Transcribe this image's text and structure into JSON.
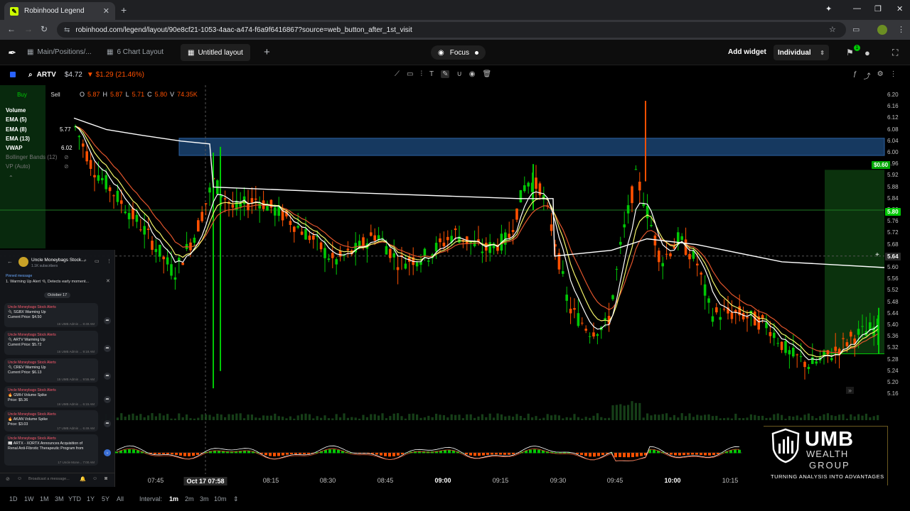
{
  "browser": {
    "tab_title": "Robinhood Legend",
    "url_site": "⇆",
    "url": "robinhood.com/legend/layout/90e8cf21-1053-4aac-a474-f6a9f6416867?source=web_button_after_1st_visit"
  },
  "header": {
    "tabs": [
      {
        "label": "Main/Positions/..."
      },
      {
        "label": "6 Chart Layout"
      },
      {
        "label": "Untitled layout"
      }
    ],
    "focus_label": "Focus",
    "add_widget_label": "Add widget",
    "account_label": "Individual",
    "notification_count": "1"
  },
  "symbol_bar": {
    "symbol": "ARTV",
    "price": "$4.72",
    "change": "▼ $1.29 (21.46%)"
  },
  "ohlc": {
    "o_label": "O",
    "o": "5.87",
    "h_label": "H",
    "h": "5.87",
    "l_label": "L",
    "l": "5.71",
    "c_label": "C",
    "c": "5.80",
    "v_label": "V",
    "v": "74.35K"
  },
  "legend": {
    "buy": "Buy",
    "sell": "Sell",
    "indicators": [
      {
        "name": "Volume",
        "value": ""
      },
      {
        "name": "EMA (5)",
        "value": ""
      },
      {
        "name": "EMA (8)",
        "value": "5.77"
      },
      {
        "name": "EMA (13)",
        "value": ""
      },
      {
        "name": "VWAP",
        "value": "6.02"
      },
      {
        "name": "Bollinger Bands (12)",
        "value": ""
      },
      {
        "name": "VP (Auto)",
        "value": ""
      }
    ]
  },
  "price_axis": {
    "ticks": [
      "6.20",
      "6.16",
      "6.12",
      "6.08",
      "6.04",
      "6.00",
      "5.96",
      "5.92",
      "5.88",
      "5.84",
      "5.80",
      "5.76",
      "5.72",
      "5.68",
      "5.64",
      "5.60",
      "5.56",
      "5.52",
      "5.48",
      "5.44",
      "5.40",
      "5.36",
      "5.32",
      "5.28",
      "5.24",
      "5.20",
      "5.16"
    ],
    "current_tag": "5.80",
    "crosshair_tag": "5.64",
    "green_tag": "$0.60"
  },
  "time_axis": {
    "labels": [
      "07:45",
      "Oct 17 07:58",
      "08:15",
      "08:30",
      "08:45",
      "09:00",
      "09:15",
      "09:30",
      "09:45",
      "10:00",
      "10:15"
    ]
  },
  "bottom": {
    "ranges": [
      "1D",
      "1W",
      "1M",
      "3M",
      "YTD",
      "1Y",
      "5Y",
      "All"
    ],
    "interval_label": "Interval:",
    "intervals": [
      "1m",
      "2m",
      "3m",
      "10m"
    ]
  },
  "telegram": {
    "channel": "Uncle Moneybags Stock...",
    "subscribers": "1.1K subscribers",
    "pinned_label": "Pinned message",
    "pinned_text": "1. Warming Up Alert 🔌 Detects early moment...",
    "date": "October 17",
    "messages": [
      {
        "title": "Uncle Moneybags Stock Alerts",
        "line1": "🔌 SGBX Warming Up",
        "line2": "Current Price: $4.50",
        "meta": "16 UMB Admin ... 8:49 AM"
      },
      {
        "title": "Uncle Moneybags Stock Alerts",
        "line1": "🔌 ARTV Warming Up",
        "line2": "Current Price: $5.72",
        "meta": "16 UMB Admin ... 9:18 AM"
      },
      {
        "title": "Uncle Moneybags Stock Alerts",
        "line1": "🔌 CREV Warming Up",
        "line2": "Current Price: $6.13",
        "meta": "15 UMB Admin ... 9:55 AM"
      },
      {
        "title": "Uncle Moneybags Stock Alerts",
        "line1": "🔥 GWH Volume Spike",
        "line2": "Price: $5.36",
        "meta": "16 UMB Admin ... 6:15 AM"
      },
      {
        "title": "Uncle Moneybags Stock Alerts",
        "line1": "🔥 AKAN Volume Spike",
        "line2": "Price: $3.03",
        "meta": "17 UMB Admin ... 6:49 AM"
      },
      {
        "title": "Uncle Moneybags Stock Alerts",
        "line1": "📰 ARTX - XORTX Announces Acquisition of",
        "line2": "Renal Anti-Fibrotic Therapeutic Program from",
        "meta": "17 Uncle Mone... 7:00 AM"
      }
    ],
    "input_placeholder": "Broadcast a message..."
  },
  "brand": {
    "name": "UMB",
    "line1": "WEALTH",
    "line2": "GROUP",
    "tagline": "TURNING ANALYSIS INTO ADVANTAGES"
  },
  "colors": {
    "up": "#00c805",
    "down": "#ff5000",
    "ema_fast": "#ffffff",
    "ema_mid": "#f5f56a",
    "ema_slow": "#e0542b",
    "vwap": "#ffffff",
    "zone": "#1e4d80"
  }
}
